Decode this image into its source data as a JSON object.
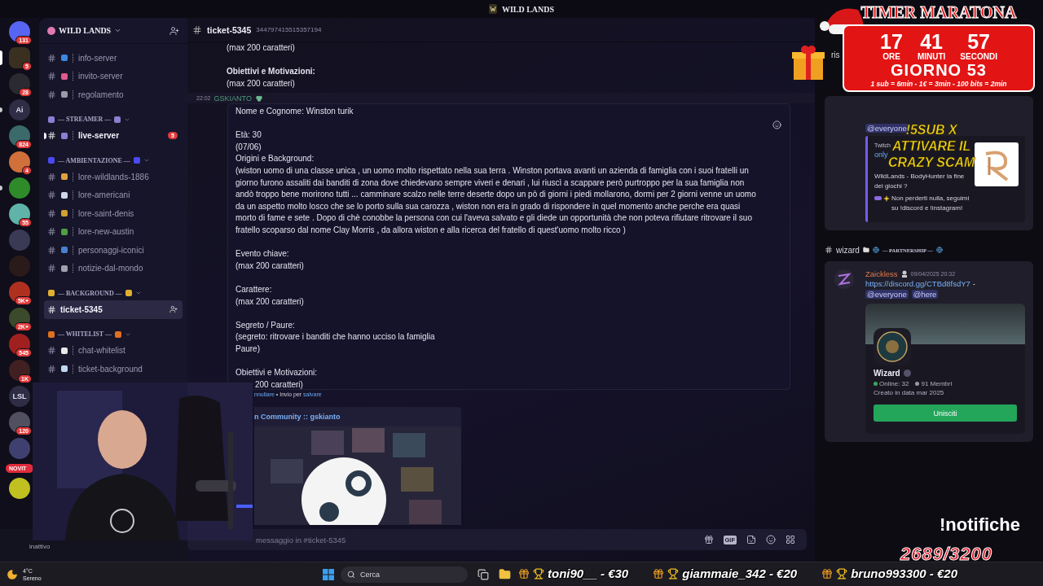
{
  "window": {
    "title": "WILD LANDS"
  },
  "server_rail": [
    {
      "kind": "avatar",
      "badge": "131",
      "selected": false
    },
    {
      "kind": "avatar",
      "badge": "5",
      "selected": true
    },
    {
      "kind": "avatar",
      "badge": "28",
      "selected": false
    },
    {
      "kind": "text",
      "label": "Ai",
      "selected": false,
      "unread": true
    },
    {
      "kind": "avatar",
      "badge": "824",
      "selected": false
    },
    {
      "kind": "avatar",
      "badge": "4",
      "selected": false
    },
    {
      "kind": "avatar",
      "selected": false,
      "unread": true
    },
    {
      "kind": "avatar",
      "badge": "55",
      "selected": false
    },
    {
      "kind": "avatar",
      "selected": false
    },
    {
      "kind": "avatar",
      "selected": false
    },
    {
      "kind": "avatar",
      "badge": "5K+",
      "selected": false
    },
    {
      "kind": "avatar",
      "badge": "2K+",
      "selected": false
    },
    {
      "kind": "avatar",
      "badge": "545",
      "selected": false
    },
    {
      "kind": "avatar",
      "badge": "1K",
      "selected": false
    },
    {
      "kind": "text",
      "label": "LSL",
      "selected": false
    },
    {
      "kind": "avatar",
      "badge": "120",
      "selected": false
    },
    {
      "kind": "avatar",
      "selected": false
    },
    {
      "kind": "pill",
      "label": "NOVIT"
    },
    {
      "kind": "avatar",
      "selected": false
    }
  ],
  "channels": {
    "server_name": "WILD LANDS",
    "groups": [
      {
        "items": [
          {
            "name": "info-server",
            "color": "#3b88e0",
            "selected": false,
            "unread": false
          },
          {
            "name": "invito-server",
            "color": "#e05a8a",
            "selected": false,
            "unread": false
          },
          {
            "name": "regolamento",
            "color": "#9a9aa8",
            "selected": false,
            "unread": false
          }
        ]
      },
      {
        "title": "— STREAMER —",
        "color": "#8a7fd0",
        "items": [
          {
            "name": "live-server",
            "color": "#8a7fd0",
            "selected": false,
            "unread": true,
            "badge": "5"
          }
        ]
      },
      {
        "title": "— AMBIENTAZIONE —",
        "color": "#4a4af0",
        "items": [
          {
            "name": "lore-wildlands-1886",
            "color": "#e0a040",
            "selected": false,
            "unread": false
          },
          {
            "name": "lore-americani",
            "color": "#d0d8e8",
            "selected": false,
            "unread": false
          },
          {
            "name": "lore-saint-denis",
            "color": "#d0a030",
            "selected": false,
            "unread": false
          },
          {
            "name": "lore-new-austin",
            "color": "#50a040",
            "selected": false,
            "unread": false
          },
          {
            "name": "personaggi-iconici",
            "color": "#4a80d0",
            "selected": false,
            "unread": false
          },
          {
            "name": "notizie-dal-mondo",
            "color": "#a0a0b0",
            "selected": false,
            "unread": false
          }
        ]
      },
      {
        "title": "— BACKGROUND —",
        "color": "#e0b030",
        "items": [
          {
            "name": "ticket-5345",
            "selected": true,
            "unread": false
          }
        ]
      },
      {
        "title": "— WHITELIST —",
        "color": "#e07020",
        "items": [
          {
            "name": "chat-whitelist",
            "color": "#e8e8e8",
            "selected": false,
            "unread": false
          },
          {
            "name": "ticket-background",
            "color": "#c0d8f0",
            "selected": false,
            "unread": false
          }
        ]
      }
    ]
  },
  "user_bar": {
    "status": "inattivo"
  },
  "chat": {
    "header": {
      "channel": "ticket-5345",
      "id": "344797415515357194"
    },
    "previous_blocks": [
      [
        {
          "text": "(max 200 caratteri)",
          "bold": false
        }
      ],
      [
        {
          "text": "Obiettivi e Motivazioni:",
          "bold": true
        },
        {
          "text": "(max 200 caratteri)",
          "bold": false
        }
      ]
    ],
    "editing": {
      "time": "22:02",
      "author": "GSKIANTO",
      "blocks": [
        [
          {
            "text": "Nome e Cognome:  Winston turik"
          }
        ],
        [
          {
            "text": "Età: 30"
          },
          {
            "text": "(07/06)"
          },
          {
            "text": "Origini e Background:"
          },
          {
            "text": "(wiston uomo di una classe unica , un uomo molto rispettato nella sua terra . Winston portava avanti un azienda di famiglia con i suoi fratelli un giorno furono assaliti dai banditi di zona dove chiedevano sempre viveri e denari , lui riuscì a scappare però purtroppo per la sua famiglia non andò troppo bene morirono tutti ... camminare scalzo nelle terre deserte dopo un pò di giorni i piedi mollarono, dormi per 2 giorni venne un uomo da un aspetto molto losco che se lo porto sulla sua carozza , wiston non era in grado di rispondere in quel momento anche perche era quasi morto di fame e sete . Dopo di chè conobbe la persona con cui l'aveva salvato e gli diede un opportunità che non poteva rifiutare ritrovare il suo fratello scoparso dal nome Clay Morris , da allora wiston e alla ricerca del fratello di quest'uomo molto ricco )"
          }
        ],
        [
          {
            "text": "Evento chiave:"
          },
          {
            "text": "(max 200 caratteri)"
          }
        ],
        [
          {
            "text": "Carattere:"
          },
          {
            "text": "(max 200 caratteri)"
          }
        ],
        [
          {
            "text": "Segreto / Paure:"
          },
          {
            "text": "(segreto: ritrovare i banditi che hanno ucciso la famiglia"
          },
          {
            "text": "Paure)"
          }
        ],
        [
          {
            "text": "Obiettivi e Motivazioni:"
          },
          {
            "text": "200 caratteri)",
            "indent": true
          }
        ]
      ],
      "hint": {
        "cancel": "nnullare",
        "middle": " • Invio per ",
        "save": "salvare"
      }
    },
    "embed": {
      "title": "n Community :: gskianto"
    },
    "input": {
      "placeholder": "messaggio in #ticket-5345",
      "gif_label": "GIF"
    }
  },
  "right_panel": {
    "partial_text": "ris",
    "feed_card": {
      "mention": "@everyone",
      "embed": {
        "provider": "Twitch",
        "title": "only",
        "description": [
          "WildLands - BodyHunter la fine dei giochi ?",
          "Non perderti nulla, seguimi su !discord e !instagram!"
        ]
      }
    },
    "channel_header": {
      "name": "wizard",
      "category": "— PARTNERSHIP —"
    },
    "message": {
      "author": "Zaickless",
      "time": "09/04/2025 20:32",
      "link": "https://discord.gg/CTBd8fsdY7",
      "after_link": "-",
      "mentions": [
        "@everyone",
        "@here"
      ],
      "invite": {
        "name": "Wizard",
        "online": "Online: 32",
        "members": "91 Membri",
        "created": "Creato in data mar 2025",
        "button": "Unisciti"
      }
    }
  },
  "timer": {
    "title": "TIMER MARATONA",
    "units": [
      {
        "value": "17",
        "label": "ORE"
      },
      {
        "value": "41",
        "label": "MINUTI"
      },
      {
        "value": "57",
        "label": "SECONDI"
      }
    ],
    "day": "GIORNO 53",
    "rates": "1 sub = 6min - 1€ = 3min - 100 bits = 2min"
  },
  "stream_overlay": {
    "promo_lines": [
      "!5SUB X",
      "ATTIVARE IL",
      "CRAZY SCAM"
    ],
    "notifiche": "!notifiche",
    "counter": "2689/3200",
    "ticker": [
      "toni90__ - €30",
      "giammaie_342 - €20",
      "bruno993300 - €20"
    ]
  },
  "taskbar": {
    "weather": {
      "temp": "4°C",
      "condition": "Sereno"
    },
    "search": {
      "placeholder": "Cerca"
    }
  }
}
